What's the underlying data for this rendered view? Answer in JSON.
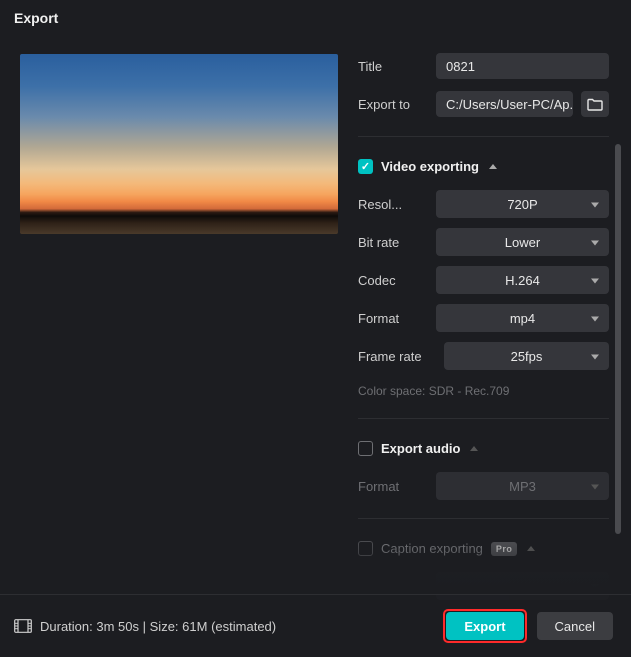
{
  "window": {
    "title": "Export"
  },
  "fields": {
    "title_label": "Title",
    "title_value": "0821",
    "export_to_label": "Export to",
    "export_to_value": "C:/Users/User-PC/Ap..."
  },
  "video_section": {
    "header": "Video exporting",
    "checked": true,
    "resolution_label": "Resol...",
    "resolution_value": "720P",
    "bitrate_label": "Bit rate",
    "bitrate_value": "Lower",
    "codec_label": "Codec",
    "codec_value": "H.264",
    "format_label": "Format",
    "format_value": "mp4",
    "framerate_label": "Frame rate",
    "framerate_value": "25fps",
    "colorspace_note": "Color space: SDR - Rec.709"
  },
  "audio_section": {
    "header": "Export audio",
    "checked": false,
    "format_label": "Format",
    "format_value": "MP3"
  },
  "caption_section": {
    "header": "Caption exporting",
    "pro_badge": "Pro"
  },
  "footer": {
    "duration_label": "Duration:",
    "duration_value": "3m 50s",
    "size_label": "Size:",
    "size_value": "61M",
    "estimated": "(estimated)",
    "export_btn": "Export",
    "cancel_btn": "Cancel"
  }
}
